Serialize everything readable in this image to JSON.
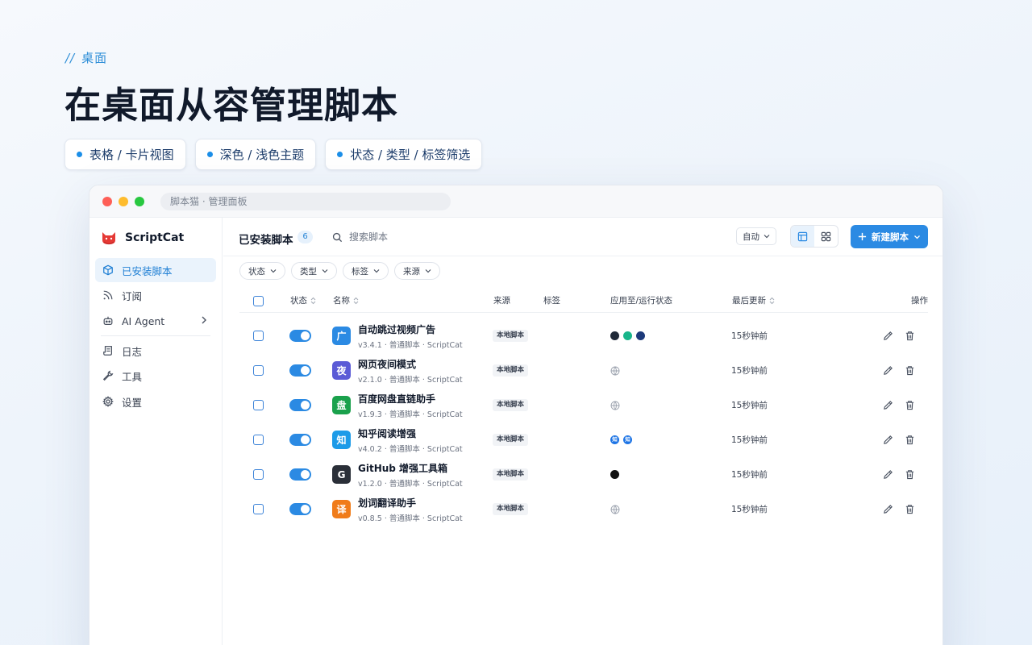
{
  "hero": {
    "eyebrow_slashes": "//",
    "eyebrow": "桌面",
    "title": "在桌面从容管理脚本",
    "chips": [
      "表格 / 卡片视图",
      "深色 / 浅色主题",
      "状态 / 类型 / 标签筛选"
    ]
  },
  "window": {
    "address": "脚本猫 · 管理面板"
  },
  "sidebar": {
    "brand": "ScriptCat",
    "items": [
      {
        "label": "已安装脚本",
        "icon": "cube-icon"
      },
      {
        "label": "订阅",
        "icon": "rss-icon"
      },
      {
        "label": "AI Agent",
        "icon": "robot-icon"
      },
      {
        "label": "日志",
        "icon": "scroll-icon"
      },
      {
        "label": "工具",
        "icon": "wrench-icon"
      },
      {
        "label": "设置",
        "icon": "gear-icon"
      }
    ]
  },
  "toolbar": {
    "title": "已安装脚本",
    "count": "6",
    "search_placeholder": "搜索脚本",
    "lang_select": "自动",
    "new_button": "新建脚本"
  },
  "filters": [
    "状态",
    "类型",
    "标签",
    "来源"
  ],
  "table": {
    "headers": {
      "status": "状态",
      "name": "名称",
      "source": "来源",
      "tags": "标签",
      "apply": "应用至/运行状态",
      "updated": "最后更新",
      "actions": "操作"
    },
    "rows": [
      {
        "icon_text": "广",
        "icon_color": "#2b8ae3",
        "name": "自动跳过视频广告",
        "meta": "v3.4.1 · 普通脚本 · ScriptCat",
        "source": "本地脚本",
        "updated": "15秒钟前",
        "sites": [
          "bilibili",
          "iqiyi",
          "youku"
        ]
      },
      {
        "icon_text": "夜",
        "icon_color": "#5b5bd6",
        "name": "网页夜间模式",
        "meta": "v2.1.0 · 普通脚本 · ScriptCat",
        "source": "本地脚本",
        "updated": "15秒钟前",
        "sites": [
          "globe"
        ]
      },
      {
        "icon_text": "盘",
        "icon_color": "#1aa14c",
        "name": "百度网盘直链助手",
        "meta": "v1.9.3 · 普通脚本 · ScriptCat",
        "source": "本地脚本",
        "updated": "15秒钟前",
        "sites": [
          "globe"
        ]
      },
      {
        "icon_text": "知",
        "icon_color": "#1d9be8",
        "name": "知乎阅读增强",
        "meta": "v4.0.2 · 普通脚本 · ScriptCat",
        "source": "本地脚本",
        "updated": "15秒钟前",
        "sites": [
          "zhihu",
          "zhihu"
        ],
        "site_labels": [
          "知",
          "知"
        ]
      },
      {
        "icon_text": "G",
        "icon_color": "#2a2f38",
        "name": "GitHub 增强工具箱",
        "meta": "v1.2.0 · 普通脚本 · ScriptCat",
        "source": "本地脚本",
        "updated": "15秒钟前",
        "sites": [
          "github"
        ]
      },
      {
        "icon_text": "译",
        "icon_color": "#f07c1a",
        "name": "划词翻译助手",
        "meta": "v0.8.5 · 普通脚本 · ScriptCat",
        "source": "本地脚本",
        "updated": "15秒钟前",
        "sites": [
          "globe"
        ]
      }
    ]
  }
}
